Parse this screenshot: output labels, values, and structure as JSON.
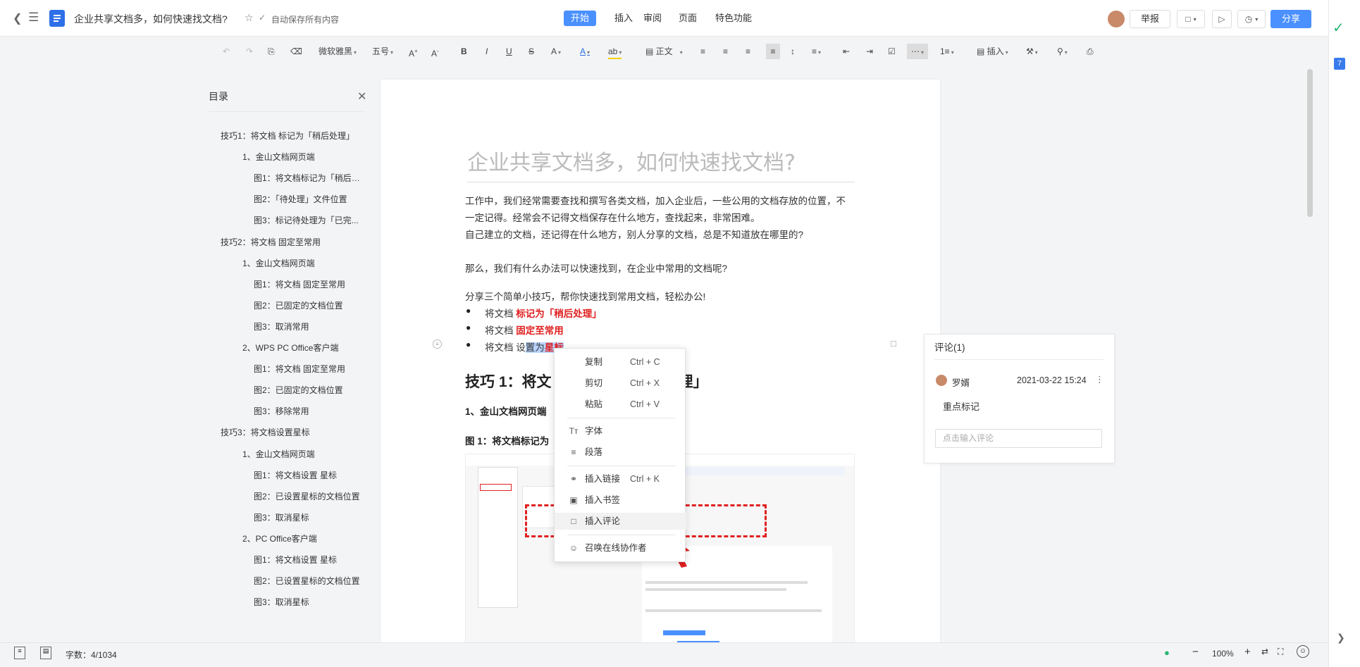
{
  "app": {
    "doc_title": "企业共享文档多，如何快速找文档?",
    "autosave": "自动保存所有内容"
  },
  "menu_tabs": [
    {
      "label": "开始",
      "active": true
    },
    {
      "label": "插入"
    },
    {
      "label": "审阅"
    },
    {
      "label": "页面"
    },
    {
      "label": "特色功能"
    }
  ],
  "header_right": {
    "report": "举报",
    "share": "分享"
  },
  "toolbar": {
    "font_name": "微软雅黑",
    "font_size": "五号",
    "style": "正文",
    "insert": "插入"
  },
  "toc": {
    "title": "目录",
    "items": [
      {
        "label": "技巧1：将文档 标记为「稍后处理」",
        "level": 0
      },
      {
        "label": "1、金山文档网页端",
        "level": 1
      },
      {
        "label": "图1：将文档标记为「稍后处...",
        "level": 2
      },
      {
        "label": "图2：「待处理」文件位置",
        "level": 2
      },
      {
        "label": "图3：标记待处理为「已完...",
        "level": 2
      },
      {
        "label": "技巧2：将文档 固定至常用",
        "level": 0
      },
      {
        "label": "1、金山文档网页端",
        "level": 1
      },
      {
        "label": "图1：将文档 固定至常用",
        "level": 2
      },
      {
        "label": "图2：已固定的文档位置",
        "level": 2
      },
      {
        "label": "图3：取消常用",
        "level": 2
      },
      {
        "label": "2、WPS PC Office客户端",
        "level": 1
      },
      {
        "label": "图1：将文档 固定至常用",
        "level": 2
      },
      {
        "label": "图2：已固定的文档位置",
        "level": 2
      },
      {
        "label": "图3：移除常用",
        "level": 2
      },
      {
        "label": "技巧3：将文档设置星标",
        "level": 0
      },
      {
        "label": "1、金山文档网页端",
        "level": 1
      },
      {
        "label": "图1：将文档设置 星标",
        "level": 2
      },
      {
        "label": "图2：已设置星标的文档位置",
        "level": 2
      },
      {
        "label": "图3：取消星标",
        "level": 2
      },
      {
        "label": "2、PC Office客户端",
        "level": 1
      },
      {
        "label": "图1：将文档设置 星标",
        "level": 2
      },
      {
        "label": "图2：已设置星标的文档位置",
        "level": 2
      },
      {
        "label": "图3：取消星标",
        "level": 2
      }
    ]
  },
  "doc": {
    "heading": "企业共享文档多，如何快速找文档?",
    "p1a": "工作中，我们经常需要查找和撰写各类文档，加入企业后，一些公用的文档存放的位置，不",
    "p1b": "一定记得。经常会不记得文档保存在什么地方，查找起来，非常困难。",
    "p1c": "自己建立的文档，还记得在什么地方，别人分享的文档，总是不知道放在哪里的?",
    "p2": "那么，我们有什么办法可以快速找到，在企业中常用的文档呢?",
    "p3": "分享三个简单小技巧，帮你快速找到常用文档，轻松办公!",
    "bullets": [
      {
        "prefix": "将文档 ",
        "highlight": "标记为「稍后处理」"
      },
      {
        "prefix": "将文档 ",
        "highlight": "固定至常用"
      },
      {
        "prefix": "将文档 设",
        "selected": "置为",
        "highlight": "星标"
      }
    ],
    "h2": "技巧 1：将文",
    "h2_tail": "理」",
    "sub1": "1、金山文档网页端",
    "fig1": "图 1：将文档标记为"
  },
  "context_menu": {
    "items": [
      {
        "label": "复制",
        "key": "Ctrl + C",
        "icon": ""
      },
      {
        "label": "剪切",
        "key": "Ctrl + X",
        "icon": ""
      },
      {
        "label": "粘贴",
        "key": "Ctrl + V",
        "icon": ""
      },
      {
        "label": "字体",
        "key": "",
        "icon": "font-icon"
      },
      {
        "label": "段落",
        "key": "",
        "icon": "paragraph-icon"
      },
      {
        "label": "插入链接",
        "key": "Ctrl + K",
        "icon": "link-icon"
      },
      {
        "label": "插入书签",
        "key": "",
        "icon": "bookmark-icon"
      },
      {
        "label": "插入评论",
        "key": "",
        "icon": "comment-icon"
      },
      {
        "label": "召唤在线协作者",
        "key": "",
        "icon": "mention-icon"
      }
    ]
  },
  "comments": {
    "title": "评论(1)",
    "user": "罗婿",
    "time": "2021-03-22 15:24",
    "text": "重点标记",
    "placeholder": "点击输入评论"
  },
  "status": {
    "word_count": "字数：4/1034",
    "zoom": "100%"
  },
  "colors": {
    "accent": "#4a90ff",
    "highlight_red": "#e02020"
  }
}
